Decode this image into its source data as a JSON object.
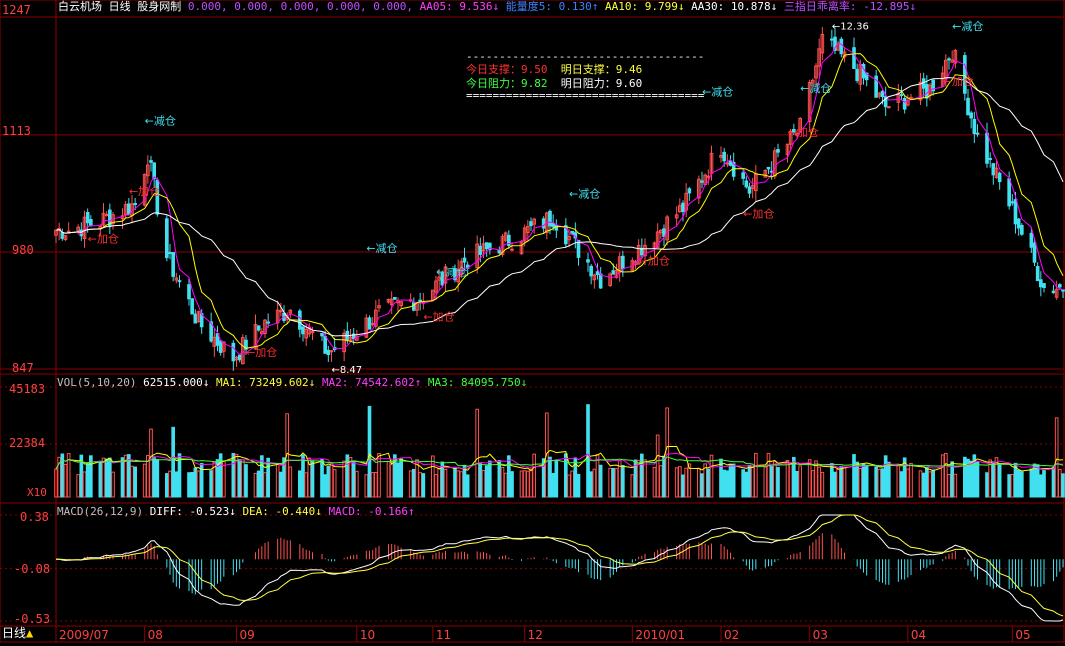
{
  "window": {
    "title": "白云机场",
    "period_tab": "日线",
    "formula_name": "股身网制"
  },
  "header": {
    "values_prefix": "0.000, 0.000, 0.000, 0.000, 0.000,",
    "aa05": "AA05: 9.536↓",
    "energy": "能量度5: 0.130↑",
    "aa10": "AA10: 9.799↓",
    "aa30": "AA30: 10.878↓",
    "deviation": "三指日乖离率: -12.895↓"
  },
  "colors": {
    "up": "#ff5050",
    "down": "#40e0f0",
    "ma_fast": "#ff00ff",
    "ma_slow": "#ffff00",
    "ma_long": "#ffffff",
    "grid": "#8b0000",
    "axis_text": "#ff4040",
    "signal_sell": "#40e0f0",
    "signal_buy": "#ff3030"
  },
  "info_box": {
    "today_support": "今日支撑：9.50",
    "tomorrow_support": "明日支撑：9.46",
    "today_resist": "今日阻力：9.82",
    "tomorrow_resist": "明日阻力：9.60"
  },
  "price_axis": {
    "ticks": [
      "1247",
      "1113",
      "980",
      "847"
    ]
  },
  "price_annotations": {
    "high": "12.36",
    "low": "8.47"
  },
  "signals": [
    {
      "label": "←减仓",
      "type": "sell",
      "x": "2009-08-03",
      "price": 11.25
    },
    {
      "label": "←加仓",
      "type": "buy",
      "x": "2009-07-29",
      "price": 10.45
    },
    {
      "label": "←加仓",
      "type": "buy",
      "x": "2009-07-16",
      "price": 9.91
    },
    {
      "label": "←减仓",
      "type": "sell",
      "x": "2009-10-12",
      "price": 9.8
    },
    {
      "label": "←加仓",
      "type": "buy",
      "x": "2009-09-04",
      "price": 8.62
    },
    {
      "label": "←减仓",
      "type": "sell",
      "x": "2009-11-03",
      "price": 9.53
    },
    {
      "label": "←加仓",
      "type": "buy",
      "x": "2009-10-30",
      "price": 9.02
    },
    {
      "label": "←减仓",
      "type": "sell",
      "x": "2009-12-15",
      "price": 10.42
    },
    {
      "label": "←加仓",
      "type": "buy",
      "x": "2010-01-06",
      "price": 9.66
    },
    {
      "label": "←加仓",
      "type": "buy",
      "x": "2010-02-08",
      "price": 10.19
    },
    {
      "label": "←减仓",
      "type": "sell",
      "x": "2010-01-26",
      "price": 11.58
    },
    {
      "label": "←减仓",
      "type": "sell",
      "x": "2010-02-26",
      "price": 11.62
    },
    {
      "label": "←加仓",
      "type": "buy",
      "x": "2010-02-22",
      "price": 11.12
    },
    {
      "label": "←减仓",
      "type": "sell",
      "x": "2010-04-15",
      "price": 12.32
    },
    {
      "label": "←加仓",
      "type": "buy",
      "x": "2010-04-12",
      "price": 11.7
    }
  ],
  "volume": {
    "header": "VOL(5,10,20)",
    "current": "62515.000↓",
    "ma1": "MA1: 73249.602↓",
    "ma2": "MA2: 74542.602↑",
    "ma3": "MA3: 84095.750↓",
    "ticks": [
      "45183",
      "22384"
    ],
    "unit": "X10"
  },
  "macd": {
    "header": "MACD(26,12,9)",
    "diff": "DIFF: -0.523↓",
    "dea": "DEA: -0.440↓",
    "macd": "MACD: -0.166↑",
    "ticks": [
      "0.38",
      "-0.08",
      "-0.53"
    ]
  },
  "time_axis": {
    "period_label": "日线",
    "months": [
      "2009/07",
      "08",
      "09",
      "10",
      "11",
      "12",
      "2010/01",
      "02",
      "03",
      "04",
      "05"
    ]
  },
  "chart_data": {
    "type": "candlestick",
    "title": "白云机场 日线",
    "period": "2009/07 – 2010/05",
    "y_unit": "price ×100 (axis)",
    "price_ylim": [
      847,
      1247
    ],
    "price_ticks": [
      847,
      980,
      1113,
      1247
    ],
    "highest": 12.36,
    "lowest": 8.47,
    "close_series": [
      {
        "x": "2009-07-10",
        "y": 10.05
      },
      {
        "x": "2009-07-20",
        "y": 10.15
      },
      {
        "x": "2009-07-31",
        "y": 10.35
      },
      {
        "x": "2009-08-04",
        "y": 10.9
      },
      {
        "x": "2009-08-10",
        "y": 9.75
      },
      {
        "x": "2009-08-20",
        "y": 9.0
      },
      {
        "x": "2009-08-31",
        "y": 8.6
      },
      {
        "x": "2009-09-10",
        "y": 9.0
      },
      {
        "x": "2009-09-18",
        "y": 9.15
      },
      {
        "x": "2009-09-30",
        "y": 8.65
      },
      {
        "x": "2009-10-16",
        "y": 9.1
      },
      {
        "x": "2009-10-30",
        "y": 9.3
      },
      {
        "x": "2009-11-12",
        "y": 9.7
      },
      {
        "x": "2009-11-30",
        "y": 10.0
      },
      {
        "x": "2009-12-10",
        "y": 10.2
      },
      {
        "x": "2009-12-25",
        "y": 9.5
      },
      {
        "x": "2010-01-08",
        "y": 9.9
      },
      {
        "x": "2010-01-20",
        "y": 10.3
      },
      {
        "x": "2010-02-01",
        "y": 11.0
      },
      {
        "x": "2010-02-10",
        "y": 10.5
      },
      {
        "x": "2010-02-26",
        "y": 11.2
      },
      {
        "x": "2010-03-05",
        "y": 12.2
      },
      {
        "x": "2010-03-15",
        "y": 11.9
      },
      {
        "x": "2010-03-25",
        "y": 11.45
      },
      {
        "x": "2010-04-08",
        "y": 11.65
      },
      {
        "x": "2010-04-15",
        "y": 12.1
      },
      {
        "x": "2010-04-23",
        "y": 11.1
      },
      {
        "x": "2010-05-05",
        "y": 10.2
      },
      {
        "x": "2010-05-14",
        "y": 9.4
      }
    ],
    "volume_ylim": [
      0,
      45183
    ],
    "volume_ticks": [
      22384,
      45183
    ],
    "macd_ylim": [
      -0.53,
      0.38
    ],
    "macd_ticks": [
      -0.53,
      -0.08,
      0.38
    ]
  }
}
